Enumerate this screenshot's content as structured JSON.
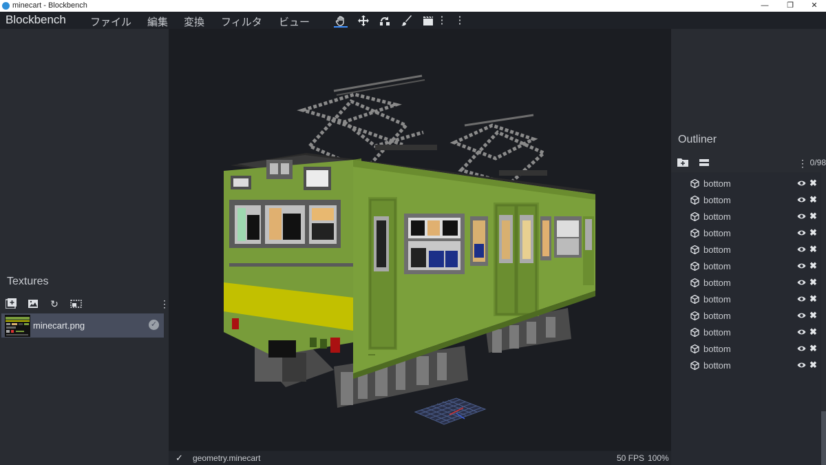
{
  "window": {
    "title": "minecart - Blockbench"
  },
  "menubar": {
    "brand": "Blockbench",
    "items": [
      "ファイル",
      "編集",
      "変換",
      "フィルタ",
      "ビュー"
    ],
    "tools": [
      "hand-tool-icon",
      "move-tool-icon",
      "resize-tool-icon",
      "paint-brush-icon",
      "animation-clapper-icon",
      "more-vertical-icon"
    ]
  },
  "textures": {
    "title": "Textures",
    "items": [
      {
        "name": "minecart.png"
      }
    ]
  },
  "outliner": {
    "title": "Outliner",
    "count": "0/98",
    "items": [
      "bottom",
      "bottom",
      "bottom",
      "bottom",
      "bottom",
      "bottom",
      "bottom",
      "bottom",
      "bottom",
      "bottom",
      "bottom",
      "bottom"
    ]
  },
  "status": {
    "model": "geometry.minecart",
    "fps": "50 FPS",
    "zoom": "100%"
  },
  "colors": {
    "accent": "#3e90ff",
    "train_body": "#7a9e3c",
    "train_stripe": "#c2c000"
  }
}
